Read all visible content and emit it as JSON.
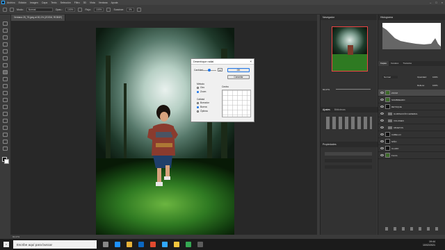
{
  "menu": [
    "Archivo",
    "Edición",
    "Imagen",
    "Capa",
    "Texto",
    "Selección",
    "Filtro",
    "3D",
    "Vista",
    "Ventana",
    "Ayuda"
  ],
  "options": {
    "mode_label": "Modo:",
    "mode_value": "Normal",
    "opacity_label": "Opac.:",
    "opacity_value": "100%",
    "flow_label": "Flujo:",
    "flow_value": "100%",
    "smooth_label": "Suavizar:",
    "smooth_value": "0%"
  },
  "document_tab": "Ventana 25_75.jpeg al 80,1% (ZOOM, RGB/8*)",
  "status_bar": "66,67%",
  "dialog": {
    "title": "Desenfoque radial",
    "amount_label": "Cantidad",
    "amount_value": "10",
    "ok": "OK",
    "cancel": "Cancelar",
    "method_label": "Método",
    "method_options": [
      "Giro",
      "Zoom"
    ],
    "quality_label": "Calidad",
    "quality_options": [
      "Borrador",
      "Buena",
      "Óptima"
    ],
    "center_label": "Centro"
  },
  "panels": {
    "navigator": "Navegador",
    "histogram": "Histograma",
    "adjustments": "Ajustes",
    "libraries": "Bibliotecas",
    "properties": "Propiedades",
    "layers_tabs": [
      "Capas",
      "Canales",
      "Trazados"
    ],
    "zoom": "66,67%",
    "blend_mode": "Normal",
    "opacity_label": "Opacidad:",
    "opacity_value": "100%",
    "fill_label": "Relleno:",
    "fill_value": "100%"
  },
  "layers": [
    {
      "name": "ZOOM",
      "kind": "layer",
      "selected": true
    },
    {
      "name": "SOMBREADO",
      "kind": "layer",
      "selected": false
    },
    {
      "name": "RETOQUE",
      "kind": "layer",
      "selected": false
    },
    {
      "name": "ILUMINACIÓN GENERAL",
      "kind": "folder",
      "selected": false
    },
    {
      "name": "VOLUMEN",
      "kind": "folder",
      "selected": false
    },
    {
      "name": "OBJETOS",
      "kind": "folder",
      "selected": false
    },
    {
      "name": "CABELLO",
      "kind": "layer",
      "selected": false
    },
    {
      "name": "NIÑO",
      "kind": "layer",
      "selected": false
    },
    {
      "name": "CLARO",
      "kind": "layer",
      "selected": false
    },
    {
      "name": "Fondo",
      "kind": "layer",
      "selected": false
    }
  ],
  "taskbar": {
    "search_placeholder": "Escribe aquí para buscar",
    "time": "19:44",
    "date": "10/02/2021"
  },
  "colors": {
    "accent": "#1a73e8",
    "nav_frame": "#ee4444",
    "panel_bg": "#323232",
    "workspace": "#282828"
  }
}
